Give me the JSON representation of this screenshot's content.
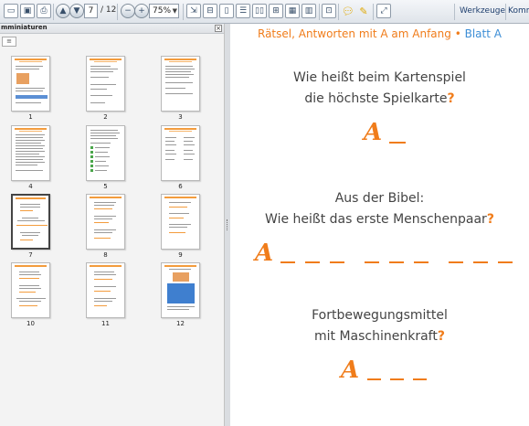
{
  "toolbar": {
    "page_current": "7",
    "page_total": "/ 12",
    "zoom": "75%",
    "tools_label": "Werkzeuge",
    "comment_label": "Komm"
  },
  "panel": {
    "title": "mminiaturen",
    "close": "×"
  },
  "thumbnails": [
    {
      "label": "1"
    },
    {
      "label": "2"
    },
    {
      "label": "3"
    },
    {
      "label": "4"
    },
    {
      "label": "5"
    },
    {
      "label": "6"
    },
    {
      "label": "7"
    },
    {
      "label": "8"
    },
    {
      "label": "9"
    },
    {
      "label": "10"
    },
    {
      "label": "11"
    },
    {
      "label": "12"
    }
  ],
  "document": {
    "header_main": "Rätsel, Antworten mit A am Anfang",
    "header_bullet": " • ",
    "header_blatt": "Blatt A",
    "q1_line1": "Wie heißt beim Kartenspiel",
    "q1_line2": "die höchste Spielkarte",
    "q2_line1": "Aus der Bibel:",
    "q2_line2": "Wie heißt das erste Menschenpaar",
    "q3_line1": "Fortbewegungsmittel",
    "q3_line2": "mit Maschinenkraft",
    "question_mark": "?",
    "answer_letter": "A"
  },
  "colors": {
    "accent_orange": "#f07c1a",
    "accent_blue": "#3d8ed6"
  }
}
